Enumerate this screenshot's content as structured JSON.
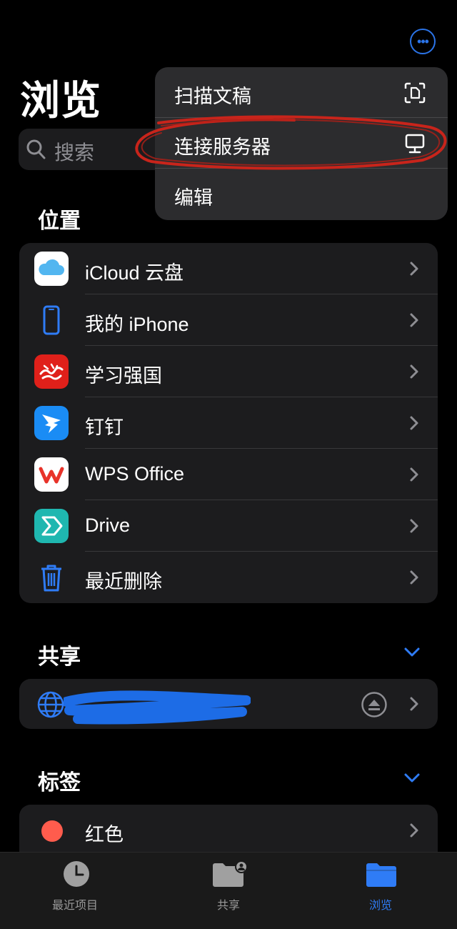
{
  "header": {
    "title": "浏览",
    "more_icon": "ellipsis-circle-icon"
  },
  "search": {
    "placeholder": "搜索"
  },
  "menu": {
    "items": [
      {
        "label": "扫描文稿",
        "icon": "doc-scan-icon"
      },
      {
        "label": "连接服务器",
        "icon": "server-display-icon"
      },
      {
        "label": "编辑",
        "icon": ""
      }
    ],
    "highlight_color": "#c8241b"
  },
  "locations": {
    "header": "位置",
    "items": [
      {
        "label": "iCloud 云盘",
        "icon": "icloud-icon"
      },
      {
        "label": "我的 iPhone",
        "icon": "iphone-icon"
      },
      {
        "label": "学习强国",
        "icon": "xuexi-qiangguo-app-icon"
      },
      {
        "label": "钉钉",
        "icon": "dingtalk-app-icon"
      },
      {
        "label": "WPS Office",
        "icon": "wps-office-app-icon"
      },
      {
        "label": "Drive",
        "icon": "drive-app-icon"
      },
      {
        "label": "最近删除",
        "icon": "trash-icon"
      }
    ]
  },
  "shared": {
    "header": "共享",
    "items": [
      {
        "label": "",
        "icon": "globe-icon",
        "redacted": true,
        "eject_icon": "eject-icon"
      }
    ]
  },
  "tags": {
    "header": "标签",
    "items": [
      {
        "label": "红色",
        "color": "#ff5c4d"
      }
    ]
  },
  "tabbar": {
    "tabs": [
      {
        "label": "最近项目",
        "icon": "clock-icon",
        "active": false
      },
      {
        "label": "共享",
        "icon": "shared-folder-icon",
        "active": false
      },
      {
        "label": "浏览",
        "icon": "folder-icon",
        "active": true
      }
    ]
  },
  "colors": {
    "accent": "#2f7cf6",
    "background": "#000000",
    "card": "#1c1c1e"
  }
}
